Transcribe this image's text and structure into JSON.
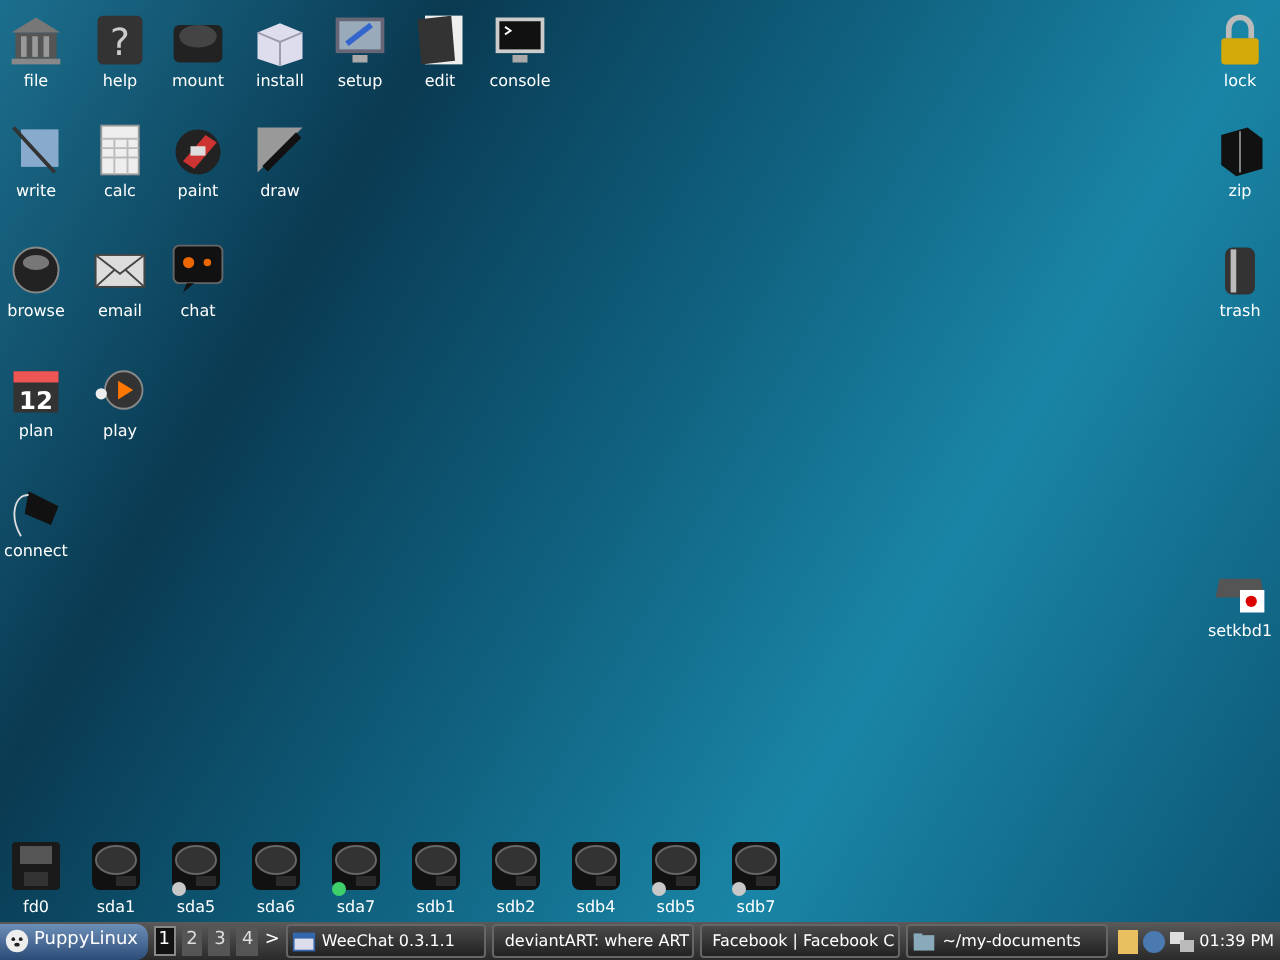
{
  "desktop_icons": [
    {
      "label": "file"
    },
    {
      "label": "help",
      "glyph": "?"
    },
    {
      "label": "mount"
    },
    {
      "label": "install"
    },
    {
      "label": "setup"
    },
    {
      "label": "edit"
    },
    {
      "label": "console"
    },
    {
      "label": "write"
    },
    {
      "label": "calc"
    },
    {
      "label": "paint"
    },
    {
      "label": "draw"
    },
    {
      "label": "browse"
    },
    {
      "label": "email"
    },
    {
      "label": "chat"
    },
    {
      "label": "plan",
      "glyph": "12"
    },
    {
      "label": "play"
    },
    {
      "label": "connect"
    },
    {
      "label": "lock"
    },
    {
      "label": "zip"
    },
    {
      "label": "trash"
    },
    {
      "label": "setkbd1"
    }
  ],
  "drives": [
    {
      "label": "fd0",
      "kind": "floppy"
    },
    {
      "label": "sda1",
      "kind": "disk"
    },
    {
      "label": "sda5",
      "kind": "disk",
      "color": "#c8c8c8"
    },
    {
      "label": "sda6",
      "kind": "disk"
    },
    {
      "label": "sda7",
      "kind": "disk",
      "color": "#3ecf6a"
    },
    {
      "label": "sdb1",
      "kind": "disk"
    },
    {
      "label": "sdb2",
      "kind": "disk"
    },
    {
      "label": "sdb4",
      "kind": "disk"
    },
    {
      "label": "sdb5",
      "kind": "disk",
      "color": "#c8c8c8"
    },
    {
      "label": "sdb7",
      "kind": "disk",
      "color": "#c8c8c8"
    }
  ],
  "taskbar": {
    "start_label": "PuppyLinux",
    "workspaces": [
      {
        "label": "1",
        "selected": true
      },
      {
        "label": "2",
        "selected": false
      },
      {
        "label": "3",
        "selected": false
      },
      {
        "label": "4",
        "selected": false
      }
    ],
    "pager_arrow": ">",
    "tasks": [
      {
        "label": "WeeChat 0.3.1.1",
        "kind": "window"
      },
      {
        "label": "deviantART: where ART",
        "kind": "browser"
      },
      {
        "label": "Facebook | Facebook C",
        "kind": "browser"
      },
      {
        "label": "~/my-documents",
        "kind": "folder"
      }
    ],
    "clock": "01:39 PM"
  }
}
